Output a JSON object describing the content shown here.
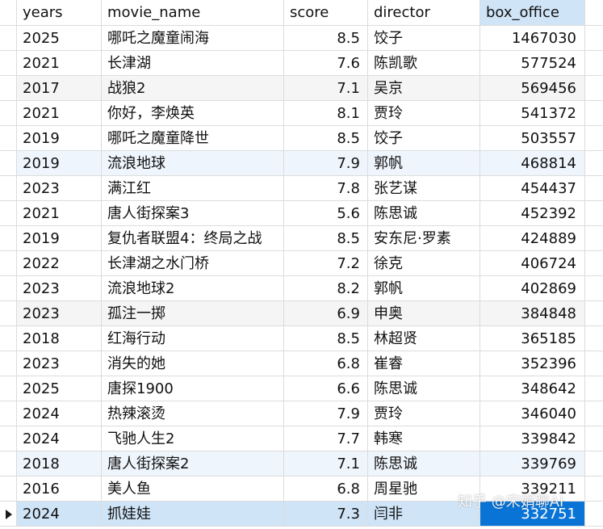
{
  "columns": {
    "years": "years",
    "movie_name": "movie_name",
    "score": "score",
    "director": "director",
    "box_office": "box_office"
  },
  "rows": [
    {
      "years": "2025",
      "movie_name": "哪吒之魔童闹海",
      "score": "8.5",
      "director": "饺子",
      "box_office": "1467030"
    },
    {
      "years": "2021",
      "movie_name": "长津湖",
      "score": "7.6",
      "director": "陈凯歌",
      "box_office": "577524"
    },
    {
      "years": "2017",
      "movie_name": "战狼2",
      "score": "7.1",
      "director": "吴京",
      "box_office": "569456"
    },
    {
      "years": "2021",
      "movie_name": "你好，李焕英",
      "score": "8.1",
      "director": "贾玲",
      "box_office": "541372"
    },
    {
      "years": "2019",
      "movie_name": "哪吒之魔童降世",
      "score": "8.5",
      "director": "饺子",
      "box_office": "503557"
    },
    {
      "years": "2019",
      "movie_name": "流浪地球",
      "score": "7.9",
      "director": "郭帆",
      "box_office": "468814"
    },
    {
      "years": "2023",
      "movie_name": "满江红",
      "score": "7.8",
      "director": "张艺谋",
      "box_office": "454437"
    },
    {
      "years": "2021",
      "movie_name": "唐人街探案3",
      "score": "5.6",
      "director": "陈思诚",
      "box_office": "452392"
    },
    {
      "years": "2019",
      "movie_name": "复仇者联盟4：终局之战",
      "score": "8.5",
      "director": "安东尼·罗素",
      "box_office": "424889"
    },
    {
      "years": "2022",
      "movie_name": "长津湖之水门桥",
      "score": "7.2",
      "director": "徐克",
      "box_office": "406724"
    },
    {
      "years": "2023",
      "movie_name": "流浪地球2",
      "score": "8.2",
      "director": "郭帆",
      "box_office": "402869"
    },
    {
      "years": "2023",
      "movie_name": "孤注一掷",
      "score": "6.9",
      "director": "申奥",
      "box_office": "384848"
    },
    {
      "years": "2018",
      "movie_name": "红海行动",
      "score": "8.5",
      "director": "林超贤",
      "box_office": "365185"
    },
    {
      "years": "2023",
      "movie_name": "消失的她",
      "score": "6.8",
      "director": "崔睿",
      "box_office": "352396"
    },
    {
      "years": "2025",
      "movie_name": "唐探1900",
      "score": "6.6",
      "director": "陈思诚",
      "box_office": "348642"
    },
    {
      "years": "2024",
      "movie_name": "热辣滚烫",
      "score": "7.9",
      "director": "贾玲",
      "box_office": "346040"
    },
    {
      "years": "2024",
      "movie_name": "飞驰人生2",
      "score": "7.7",
      "director": "韩寒",
      "box_office": "339842"
    },
    {
      "years": "2018",
      "movie_name": "唐人街探案2",
      "score": "7.1",
      "director": "陈思诚",
      "box_office": "339769"
    },
    {
      "years": "2016",
      "movie_name": "美人鱼",
      "score": "6.8",
      "director": "周星驰",
      "box_office": "339211"
    },
    {
      "years": "2024",
      "movie_name": "抓娃娃",
      "score": "7.3",
      "director": "闫非",
      "box_office": "332751"
    }
  ],
  "watermark": "知乎 @宋娟聊AI",
  "colors": {
    "header_selected_col": "#cfe4f7",
    "row_alt": "#f5f5f5",
    "row_highlight": "#eef5fc",
    "selected_row": "#cfe4f7",
    "selected_cell": "#0a74d6"
  },
  "icons": {
    "row_indicator": "current-row-arrow-icon"
  }
}
